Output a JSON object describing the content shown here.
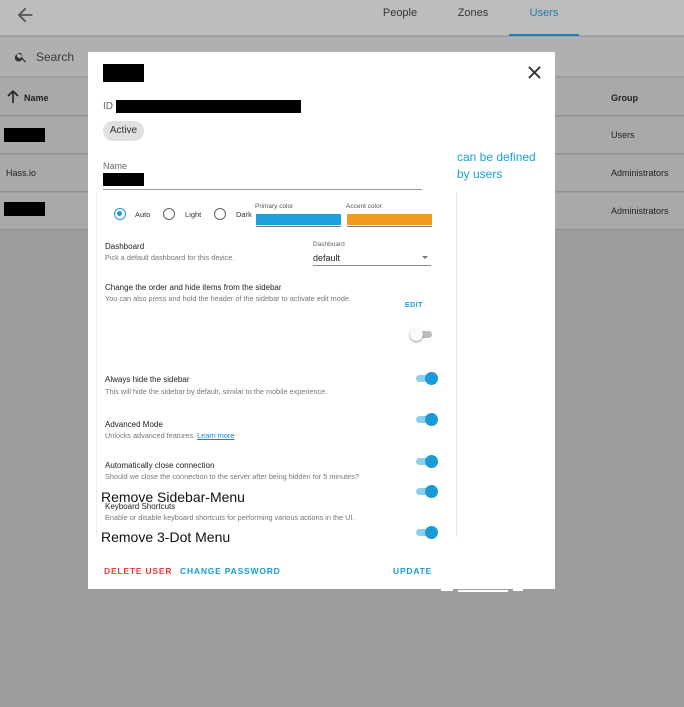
{
  "topbar": {
    "back_icon": "arrow-left-icon",
    "tabs": [
      {
        "label": "People",
        "active": false
      },
      {
        "label": "Zones",
        "active": false
      },
      {
        "label": "Users",
        "active": true
      }
    ]
  },
  "search": {
    "placeholder": "Search",
    "icon": "search-icon"
  },
  "table": {
    "headers": {
      "name": "Name",
      "group": "Group"
    },
    "rows": [
      {
        "name": "",
        "group": "Users"
      },
      {
        "name": "Hass.io",
        "group": "Administrators"
      },
      {
        "name": "",
        "group": "Administrators"
      }
    ]
  },
  "dialog": {
    "id_label": "ID",
    "status_chip": "Active",
    "name_label": "Name",
    "theme": {
      "options": [
        "Auto",
        "Light",
        "Dark"
      ],
      "selected": "Auto",
      "primary_color_label": "Primary color",
      "accent_color_label": "Accent color",
      "primary_color": "#1ba1dc",
      "accent_color": "#f19a1d"
    },
    "settings": [
      {
        "title": "Dashboard",
        "desc": "Pick a default dashboard for this device."
      },
      {
        "title": "Change the order and hide items from the sidebar",
        "desc": "You can also press and hold the header of the sidebar to activate edit mode."
      },
      {
        "title": "Always hide the sidebar",
        "desc": "This will hide the sidebar by default, similar to the mobile experience."
      },
      {
        "title": "Advanced Mode",
        "desc": "Unlocks advanced features.",
        "link": "Learn more"
      },
      {
        "title": "Automatically close connection",
        "desc": "Should we close the connection to the server after being hidden for 5 minutes?"
      },
      {
        "title": "Keyboard Shortcuts",
        "desc": "Enable or disable keyboard shortcuts for performing various actions in the UI."
      }
    ],
    "dashboard_dropdown": {
      "label": "Dashboard",
      "value": "default"
    },
    "edit_button": "EDIT",
    "extra_options": [
      "Remove Sidebar-Menu",
      "Remove 3-Dot Menu"
    ],
    "toggles_left": [
      true,
      false,
      true,
      true,
      true,
      true,
      true
    ],
    "toggles_right": [
      true,
      true,
      false,
      true,
      true,
      true,
      true,
      true
    ],
    "footer": {
      "delete": "DELETE USER",
      "change_password": "CHANGE PASSWORD",
      "update": "UPDATE"
    },
    "colors": {
      "accent": "#1a9ad6",
      "danger": "#e53935"
    }
  },
  "annotation": {
    "line1": "can be defined",
    "line2": "by users",
    "color": "#1aa0d8"
  }
}
